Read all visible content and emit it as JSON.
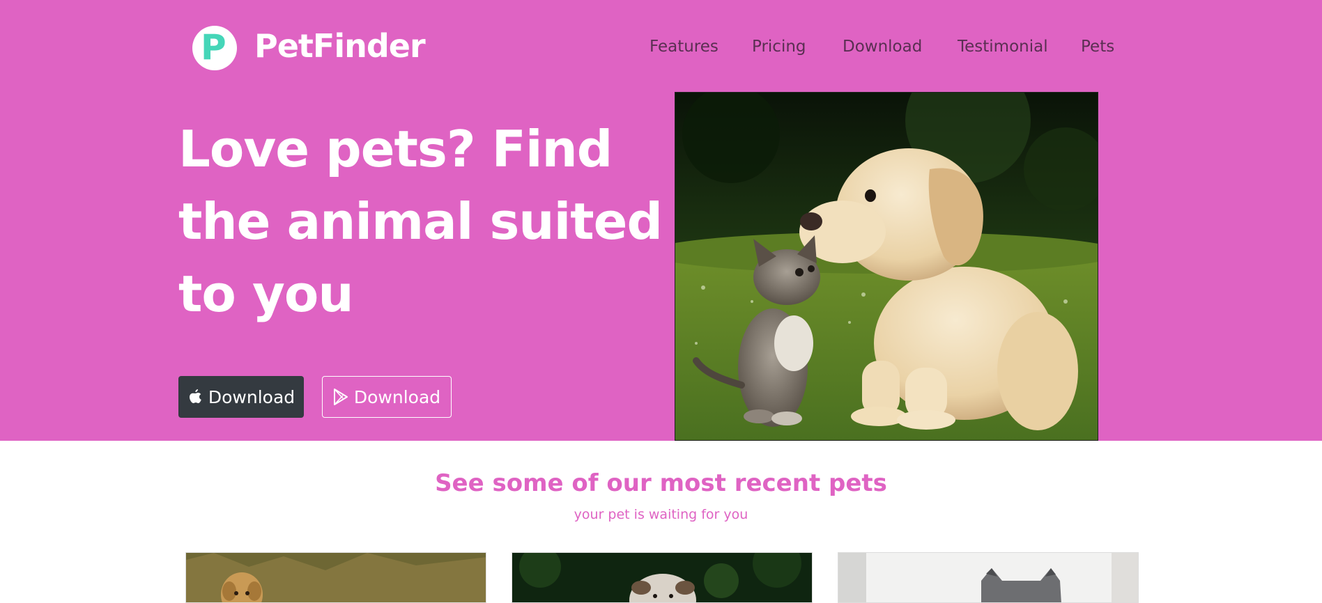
{
  "brand": {
    "name": "PetFinder",
    "logo_letter": "P"
  },
  "nav": {
    "items": [
      {
        "label": "Features"
      },
      {
        "label": "Pricing"
      },
      {
        "label": "Download"
      },
      {
        "label": "Testimonial"
      },
      {
        "label": "Pets"
      }
    ]
  },
  "hero": {
    "headline": "Love pets? Find the animal suited to you",
    "buttons": {
      "apple_label": "Download",
      "play_label": "Download"
    },
    "image_icon": "puppy-and-kitten-photo"
  },
  "recent": {
    "title": "See some of our most recent pets",
    "subtitle": "your pet is waiting for you",
    "cards": [
      {
        "icon": "dog-photo"
      },
      {
        "icon": "bulldog-photo"
      },
      {
        "icon": "cat-photo"
      }
    ]
  },
  "colors": {
    "hero_bg": "#df63c3",
    "accent": "#df63c3",
    "logo_teal": "#45d6b8",
    "dark_button": "#343a40",
    "nav_text": "#5a2f52"
  }
}
